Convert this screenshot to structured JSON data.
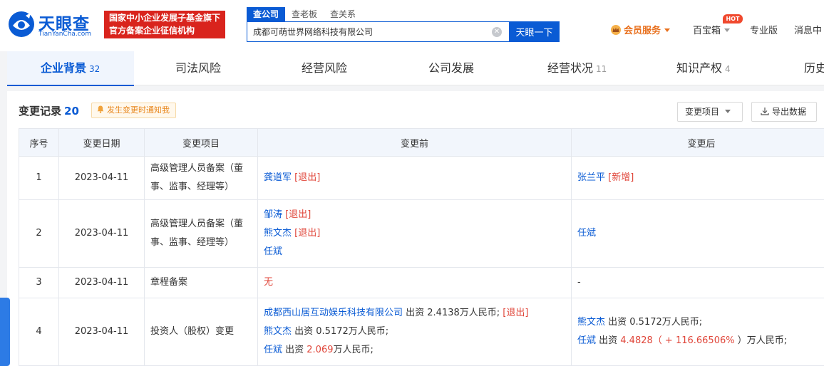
{
  "header": {
    "logo_cn": "天眼查",
    "logo_en": "TianYanCha.com",
    "slogan_line1": "国家中小企业发展子基金旗下",
    "slogan_line2": "官方备案企业征信机构",
    "search_tabs": [
      "查公司",
      "查老板",
      "查关系"
    ],
    "search_value": "成都可萌世界网络科技有限公司",
    "search_button": "天眼一下",
    "member": "会员服务",
    "baibao": "百宝箱",
    "hot": "HOT",
    "pro": "专业版",
    "msg": "消息中"
  },
  "tabs": [
    {
      "label": "企业背景",
      "count": "32"
    },
    {
      "label": "司法风险",
      "count": ""
    },
    {
      "label": "经营风险",
      "count": ""
    },
    {
      "label": "公司发展",
      "count": ""
    },
    {
      "label": "经营状况",
      "count": "11"
    },
    {
      "label": "知识产权",
      "count": "4"
    },
    {
      "label": "历史",
      "count": ""
    }
  ],
  "section": {
    "title": "变更记录",
    "count": "20",
    "notify": "发生变更时通知我",
    "filter_button": "变更项目",
    "export_button": "导出数据"
  },
  "table": {
    "headers": [
      "序号",
      "变更日期",
      "变更项目",
      "变更前",
      "变更后"
    ],
    "rows": [
      {
        "idx": "1",
        "date": "2023-04-11",
        "item": "高级管理人员备案（董事、监事、经理等）",
        "before": [
          {
            "name": "龚道军",
            "tag": "[退出]"
          }
        ],
        "after": [
          {
            "name": "张兰平",
            "tag": "[新增]"
          }
        ]
      },
      {
        "idx": "2",
        "date": "2023-04-11",
        "item": "高级管理人员备案（董事、监事、经理等）",
        "before": [
          {
            "name": "邹涛",
            "tag": "[退出]"
          },
          {
            "name": "熊文杰",
            "tag": "[退出]"
          },
          {
            "name": "任斌",
            "tag": ""
          }
        ],
        "after": [
          {
            "name": "任斌",
            "tag": ""
          }
        ]
      },
      {
        "idx": "3",
        "date": "2023-04-11",
        "item": "章程备案",
        "before_text": "无",
        "after_text": "-"
      },
      {
        "idx": "4",
        "date": "2023-04-11",
        "item": "投资人（股权）变更",
        "before4": [
          {
            "name": "成都西山居互动娱乐科技有限公司",
            "pre": " 出资 ",
            "amt": "2.4138",
            "post": "万人民币; ",
            "tag": "[退出]"
          },
          {
            "name": "熊文杰",
            "pre": " 出资 ",
            "amt": "0.5172",
            "post": "万人民币;",
            "tag": ""
          },
          {
            "name": "任斌",
            "pre": " 出资 ",
            "amt": "2.069",
            "post": "万人民币;",
            "tag": ""
          }
        ],
        "after4": [
          {
            "name": "熊文杰",
            "pre": " 出资 ",
            "amt": "0.5172",
            "post": "万人民币;",
            "change": ""
          },
          {
            "name": "任斌",
            "pre": " 出资 ",
            "amt": "4.4828",
            "post": " ）万人民币;",
            "change": "（ + 116.66506% "
          }
        ]
      }
    ]
  },
  "colors": {
    "brand": "#0a5bd4",
    "slogan_bg": "#d9241d",
    "alert": "#e0463a",
    "member": "#e86f1c"
  }
}
